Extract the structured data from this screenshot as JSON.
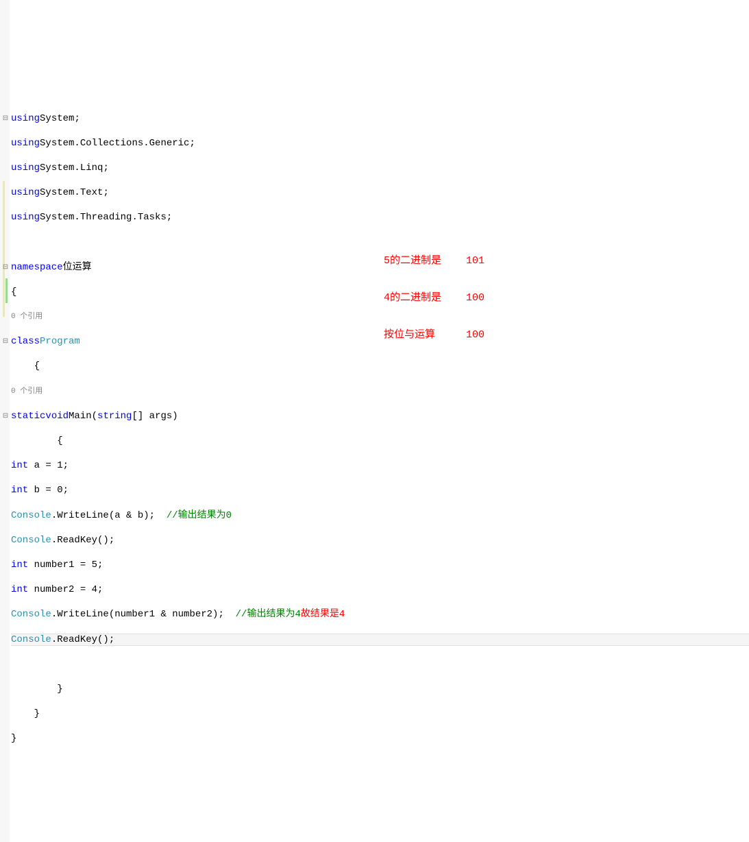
{
  "lines": {
    "l1_using": "using",
    "l1_ns": "System",
    "l2_using": "using",
    "l2_ns": "System.Collections.Generic",
    "l3_using": "using",
    "l3_ns": "System.Linq",
    "l4_using": "using",
    "l4_ns": "System.Text",
    "l5_using": "using",
    "l5_ns": "System.Threading.Tasks",
    "l7_kw": "namespace",
    "l7_name": "位运算",
    "l8_brace": "{",
    "l9_ref": "0 个引用",
    "l10_kw1": "class",
    "l10_name": "Program",
    "l11_brace": "    {",
    "l12_ref": "0 个引用",
    "l13_kw1": "static",
    "l13_kw2": "void",
    "l13_name": "Main",
    "l13_kw3": "string",
    "l13_rest": "[] args)",
    "l14_brace": "        {",
    "l15_kw": "int",
    "l15_rest": " a = 1;",
    "l16_kw": "int",
    "l16_rest": " b = 0;",
    "l17_type": "Console",
    "l17_rest": ".WriteLine(a & b);  ",
    "l17_comment": "//输出结果为0",
    "l18_type": "Console",
    "l18_rest": ".ReadKey();",
    "l19_kw": "int",
    "l19_rest": " number1 = 5;",
    "l20_kw": "int",
    "l20_rest": " number2 = 4;",
    "l21_type": "Console",
    "l21_rest": ".WriteLine(number1 & number2);  ",
    "l21_comment": "//输出结果为4",
    "l22_type": "Console",
    "l22_rest": ".ReadKey();",
    "l24_brace": "        }",
    "l25_brace": "    }",
    "l26_brace": "}"
  },
  "annotations": {
    "r1_label": "5的二进制是",
    "r1_val": "101",
    "r2_label": "4的二进制是",
    "r2_val": "100",
    "r3_label": "按位与运算",
    "r3_val": "100",
    "r4_label": "故结果是4"
  }
}
